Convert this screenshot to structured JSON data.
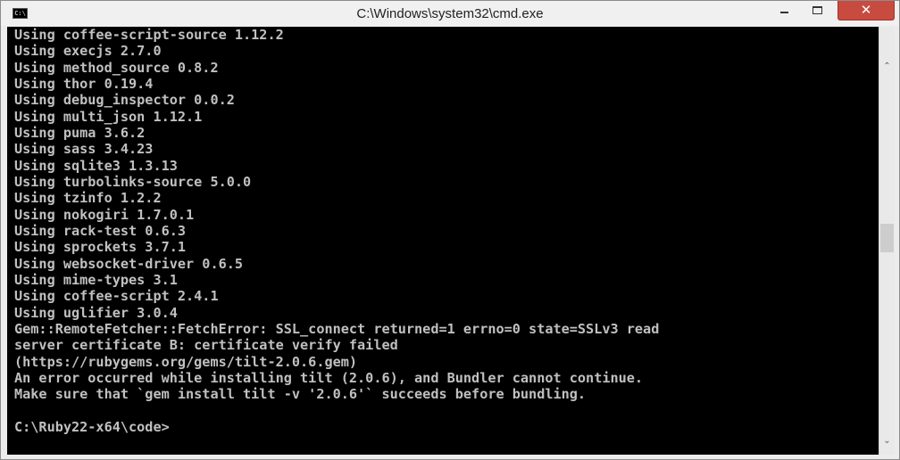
{
  "window": {
    "title": "C:\\Windows\\system32\\cmd.exe",
    "icon_label": "C:\\",
    "minimize_glyph": "",
    "close_glyph": "✕"
  },
  "colors": {
    "console_bg": "#000000",
    "console_text": "#c0c0c0",
    "close_button": "#c74b3e",
    "titlebar": "#f0f0f0"
  },
  "console": {
    "lines": [
      "Using coffee-script-source 1.12.2",
      "Using execjs 2.7.0",
      "Using method_source 0.8.2",
      "Using thor 0.19.4",
      "Using debug_inspector 0.0.2",
      "Using multi_json 1.12.1",
      "Using puma 3.6.2",
      "Using sass 3.4.23",
      "Using sqlite3 1.3.13",
      "Using turbolinks-source 5.0.0",
      "Using tzinfo 1.2.2",
      "Using nokogiri 1.7.0.1",
      "Using rack-test 0.6.3",
      "Using sprockets 3.7.1",
      "Using websocket-driver 0.6.5",
      "Using mime-types 3.1",
      "Using coffee-script 2.4.1",
      "Using uglifier 3.0.4",
      "Gem::RemoteFetcher::FetchError: SSL_connect returned=1 errno=0 state=SSLv3 read",
      "server certificate B: certificate verify failed",
      "(https://rubygems.org/gems/tilt-2.0.6.gem)",
      "An error occurred while installing tilt (2.0.6), and Bundler cannot continue.",
      "Make sure that `gem install tilt -v '2.0.6'` succeeds before bundling.",
      "",
      "C:\\Ruby22-x64\\code>"
    ]
  },
  "scrollbar": {
    "up_glyph": "⌃",
    "down_glyph": "⌄",
    "thumb_position_fraction": 0.45
  }
}
